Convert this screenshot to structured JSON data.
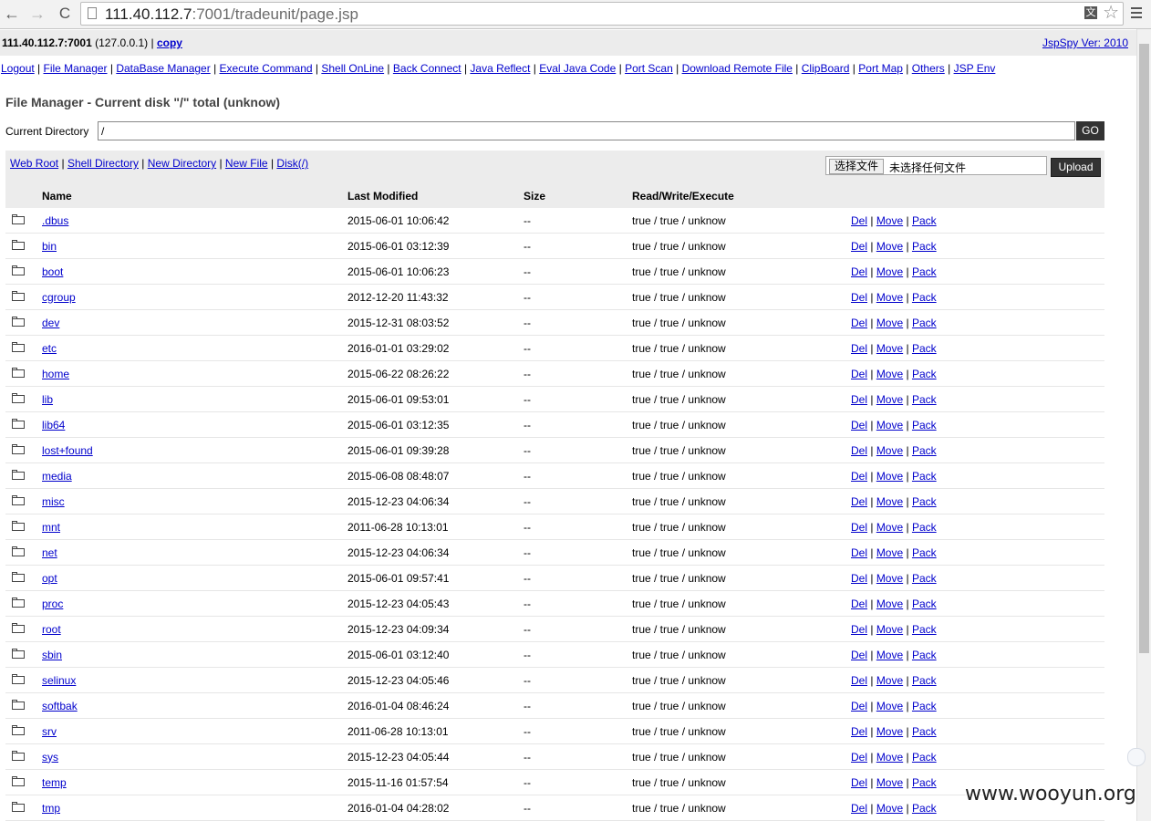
{
  "browser": {
    "url_host": "111.40.112.7",
    "url_rest": ":7001/tradeunit/page.jsp",
    "back_glyph": "←",
    "forward_glyph": "→",
    "reload_glyph": "C",
    "translate_glyph": "文",
    "star_glyph": "☆"
  },
  "header": {
    "host_bold": "111.40.112.7:7001",
    "host_ip": " (127.0.0.1) | ",
    "copy_label": "copy",
    "version_label": "JspSpy Ver: 2010"
  },
  "nav": {
    "items": [
      "Logout",
      "File Manager",
      "DataBase Manager",
      "Execute Command",
      "Shell OnLine",
      "Back Connect",
      "Java Reflect",
      "Eval Java Code",
      "Port Scan",
      "Download Remote File",
      "ClipBoard",
      "Port Map",
      "Others",
      "JSP Env"
    ]
  },
  "file_manager": {
    "title": "File Manager - Current disk \"/\" total (unknow)",
    "current_directory_label": "Current Directory",
    "current_directory_value": "/",
    "go_label": "GO",
    "quick_links": [
      "Web Root",
      "Shell Directory",
      "New Directory",
      "New File",
      "Disk(/)"
    ],
    "choose_file_label": "选择文件",
    "no_file_label": "未选择任何文件",
    "upload_label": "Upload"
  },
  "table": {
    "headers": [
      "Name",
      "Last Modified",
      "Size",
      "Read/Write/Execute"
    ],
    "action_labels": [
      "Del",
      "Move",
      "Pack"
    ],
    "rows": [
      {
        "name": ".dbus",
        "modified": "2015-06-01 10:06:42",
        "size": "--",
        "rwx": "true / true / unknow"
      },
      {
        "name": "bin",
        "modified": "2015-06-01 03:12:39",
        "size": "--",
        "rwx": "true / true / unknow"
      },
      {
        "name": "boot",
        "modified": "2015-06-01 10:06:23",
        "size": "--",
        "rwx": "true / true / unknow"
      },
      {
        "name": "cgroup",
        "modified": "2012-12-20 11:43:32",
        "size": "--",
        "rwx": "true / true / unknow"
      },
      {
        "name": "dev",
        "modified": "2015-12-31 08:03:52",
        "size": "--",
        "rwx": "true / true / unknow"
      },
      {
        "name": "etc",
        "modified": "2016-01-01 03:29:02",
        "size": "--",
        "rwx": "true / true / unknow"
      },
      {
        "name": "home",
        "modified": "2015-06-22 08:26:22",
        "size": "--",
        "rwx": "true / true / unknow"
      },
      {
        "name": "lib",
        "modified": "2015-06-01 09:53:01",
        "size": "--",
        "rwx": "true / true / unknow"
      },
      {
        "name": "lib64",
        "modified": "2015-06-01 03:12:35",
        "size": "--",
        "rwx": "true / true / unknow"
      },
      {
        "name": "lost+found",
        "modified": "2015-06-01 09:39:28",
        "size": "--",
        "rwx": "true / true / unknow"
      },
      {
        "name": "media",
        "modified": "2015-06-08 08:48:07",
        "size": "--",
        "rwx": "true / true / unknow"
      },
      {
        "name": "misc",
        "modified": "2015-12-23 04:06:34",
        "size": "--",
        "rwx": "true / true / unknow"
      },
      {
        "name": "mnt",
        "modified": "2011-06-28 10:13:01",
        "size": "--",
        "rwx": "true / true / unknow"
      },
      {
        "name": "net",
        "modified": "2015-12-23 04:06:34",
        "size": "--",
        "rwx": "true / true / unknow"
      },
      {
        "name": "opt",
        "modified": "2015-06-01 09:57:41",
        "size": "--",
        "rwx": "true / true / unknow"
      },
      {
        "name": "proc",
        "modified": "2015-12-23 04:05:43",
        "size": "--",
        "rwx": "true / true / unknow"
      },
      {
        "name": "root",
        "modified": "2015-12-23 04:09:34",
        "size": "--",
        "rwx": "true / true / unknow"
      },
      {
        "name": "sbin",
        "modified": "2015-06-01 03:12:40",
        "size": "--",
        "rwx": "true / true / unknow"
      },
      {
        "name": "selinux",
        "modified": "2015-12-23 04:05:46",
        "size": "--",
        "rwx": "true / true / unknow"
      },
      {
        "name": "softbak",
        "modified": "2016-01-04 08:46:24",
        "size": "--",
        "rwx": "true / true / unknow"
      },
      {
        "name": "srv",
        "modified": "2011-06-28 10:13:01",
        "size": "--",
        "rwx": "true / true / unknow"
      },
      {
        "name": "sys",
        "modified": "2015-12-23 04:05:44",
        "size": "--",
        "rwx": "true / true / unknow"
      },
      {
        "name": "temp",
        "modified": "2015-11-16 01:57:54",
        "size": "--",
        "rwx": "true / true / unknow"
      },
      {
        "name": "tmp",
        "modified": "2016-01-04 04:28:02",
        "size": "--",
        "rwx": "true / true / unknow"
      }
    ]
  },
  "watermark": "www.wooyun.org"
}
